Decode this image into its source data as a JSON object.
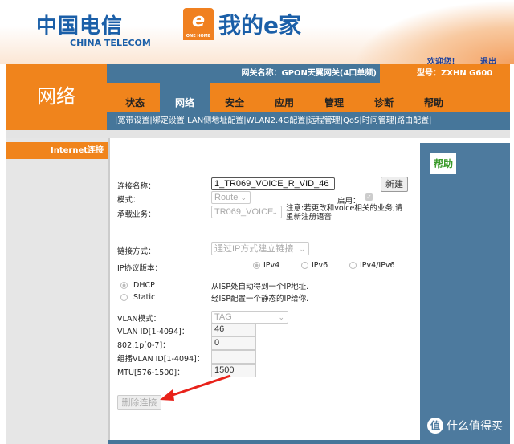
{
  "header": {
    "brand_cn": "中国电信",
    "brand_en": "CHINA TELECOM",
    "product_logo": "我的e家",
    "product_sub": "ONE HOME",
    "welcome": "欢迎您！",
    "logout": "退出"
  },
  "section_title": "网络",
  "gateway": {
    "name": "网关名称：GPON天翼网关(4口单频)",
    "model": "型号：ZXHN G600"
  },
  "tabs": [
    "状态",
    "网络",
    "安全",
    "应用",
    "管理",
    "诊断",
    "帮助"
  ],
  "active_tab": "网络",
  "submenu": [
    "宽带设置",
    "绑定设置",
    "LAN侧地址配置",
    "WLAN2.4G配置",
    "远程管理",
    "QoS",
    "时间管理",
    "路由配置"
  ],
  "sidebar": {
    "items": [
      "Internet连接"
    ]
  },
  "help_label": "帮助",
  "form": {
    "conn_name_label": "连接名称：",
    "conn_name_value": "1_TR069_VOICE_R_VID_46",
    "new_button": "新建",
    "mode_label": "模式：",
    "mode_value": "Route",
    "enable_label": "启用：",
    "service_label": "承载业务：",
    "service_value": "TR069_VOICE",
    "note": "注意:若更改和voice相关的业务,请重新注册语音",
    "link_label": "链接方式：",
    "link_value": "通过IP方式建立链接",
    "ip_label": "IP协议版本：",
    "ip_options": [
      "IPv4",
      "IPv6",
      "IPv4/IPv6"
    ],
    "addr_options": [
      {
        "label": "DHCP",
        "desc": "从ISP处自动得到一个IP地址."
      },
      {
        "label": "Static",
        "desc": "经ISP配置一个静态的IP给你."
      }
    ],
    "vlan_mode_label": "VLAN模式：",
    "vlan_mode_value": "TAG",
    "vlan_id_label": "VLAN ID[1-4094]：",
    "vlan_id_value": "46",
    "p8021_label": "802.1p[0-7]：",
    "p8021_value": "0",
    "mcast_label": "组播VLAN ID[1-4094]：",
    "mcast_value": "",
    "mtu_label": "MTU[576-1500]：",
    "mtu_value": "1500",
    "delete_button": "删除连接"
  },
  "watermark": {
    "icon": "值",
    "text": "什么值得买"
  },
  "colors": {
    "orange": "#f0841c",
    "blue": "#46769a",
    "arrow": "#e8221a"
  }
}
